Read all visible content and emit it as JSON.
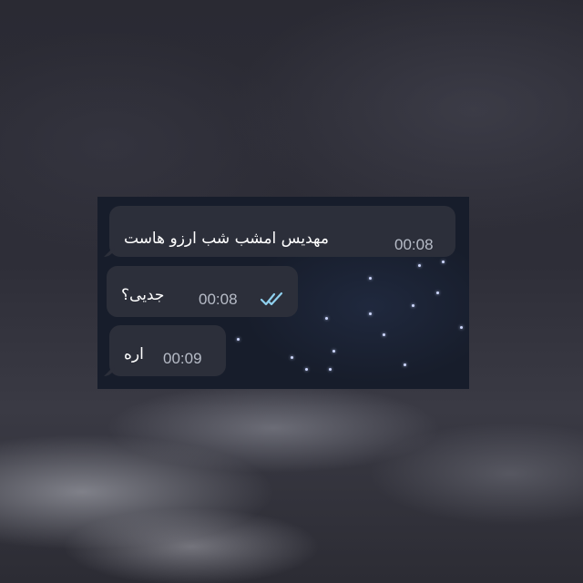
{
  "messages": [
    {
      "text": "مهدیس امشب شب ارزو هاست",
      "time": "00:08",
      "direction": "incoming"
    },
    {
      "text": "جدیی؟",
      "time": "00:08",
      "direction": "outgoing",
      "status_icon": "double-check-icon"
    },
    {
      "text": "اره",
      "time": "00:09",
      "direction": "incoming"
    }
  ],
  "colors": {
    "bubble": "#2c2f3a",
    "time_text": "#b7bcc7",
    "check_icon": "#8fd0ee",
    "panel_background": "#171d2b"
  }
}
